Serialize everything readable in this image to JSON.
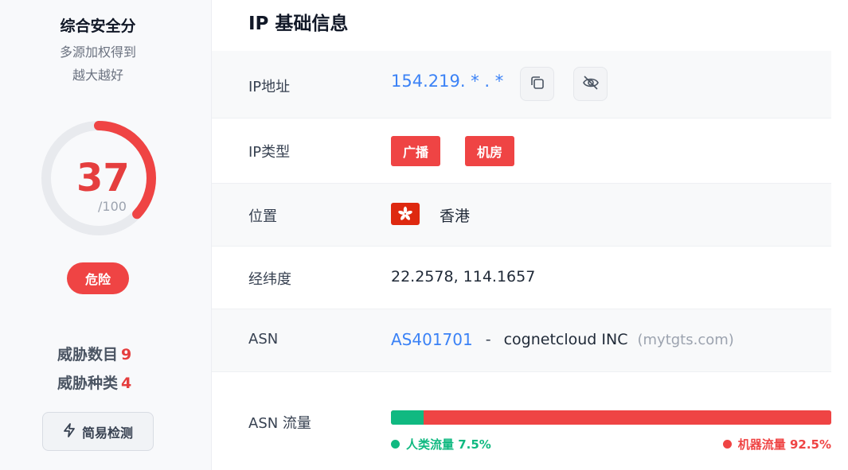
{
  "score_panel": {
    "title": "综合安全分",
    "desc_line1": "多源加权得到",
    "desc_line2": "越大越好",
    "score": "37",
    "score_value": 37,
    "score_max_label": "/100",
    "risk_label": "危险",
    "threat_count_label": "威胁数目",
    "threat_count": "9",
    "threat_types_label": "威胁种类",
    "threat_types": "4",
    "quick_check_label": "简易检测",
    "accent_color": "#ef4444"
  },
  "info": {
    "title": "IP 基础信息",
    "ip": {
      "label": "IP地址",
      "value": "154.219. * . *"
    },
    "ip_type": {
      "label": "IP类型",
      "tags": [
        "广播",
        "机房"
      ]
    },
    "location": {
      "label": "位置",
      "flag": "hong-kong-flag",
      "value": "香港"
    },
    "coords": {
      "label": "经纬度",
      "value": "22.2578, 114.1657"
    },
    "asn": {
      "label": "ASN",
      "number": "AS401701",
      "separator": "-",
      "org": "cognetcloud INC",
      "domain": "(mytgts.com)"
    },
    "asn_traffic": {
      "label": "ASN 流量",
      "human_label": "人类流量 7.5%",
      "bot_label": "机器流量 92.5%",
      "human_percent": 7.5,
      "bot_percent": 92.5,
      "human_color": "#10b981",
      "bot_color": "#ef4444"
    }
  }
}
